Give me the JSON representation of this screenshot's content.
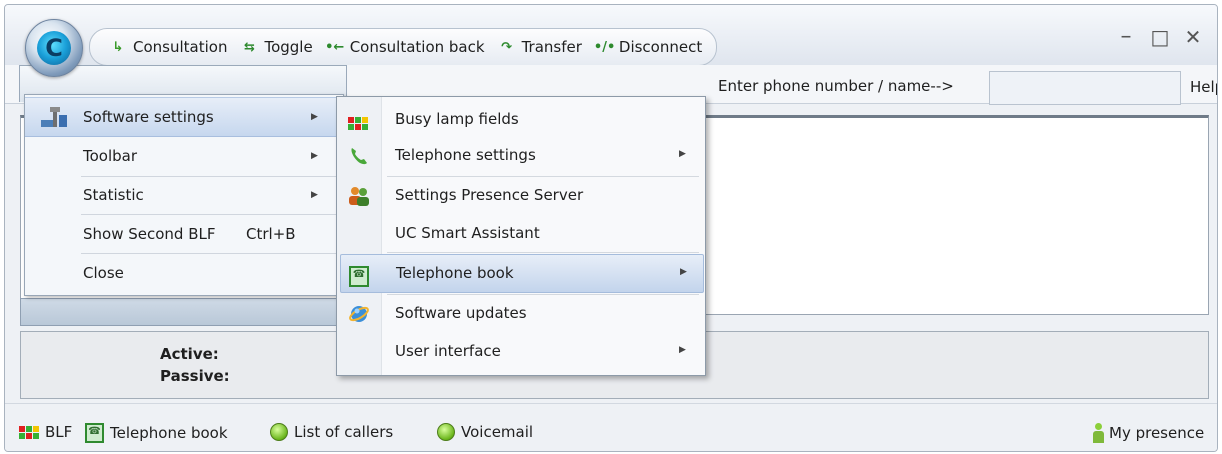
{
  "toolbar": {
    "items": [
      {
        "label": "Consultation",
        "icon": "consultation-icon",
        "glyph": "↳"
      },
      {
        "label": "Toggle",
        "icon": "toggle-icon",
        "glyph": "⇆"
      },
      {
        "label": "Consultation back",
        "icon": "consultation-back-icon",
        "glyph": "•←"
      },
      {
        "label": "Transfer",
        "icon": "transfer-icon",
        "glyph": "↷"
      },
      {
        "label": "Disconnect",
        "icon": "disconnect-icon",
        "glyph": "•/•"
      }
    ],
    "app_letter": "C"
  },
  "window_controls": {
    "minimize": "–",
    "maximize": "□",
    "close": "✕"
  },
  "search": {
    "label": "Enter phone number / name-->",
    "value": ""
  },
  "help_label": "Help",
  "main_menu": {
    "items": [
      {
        "label": "Software settings",
        "has_submenu": true
      },
      {
        "label": "Toolbar",
        "has_submenu": true
      },
      {
        "label": "Statistic",
        "has_submenu": true
      },
      {
        "label": "Show Second BLF",
        "shortcut": "Ctrl+B"
      },
      {
        "label": "Close"
      }
    ]
  },
  "submenu": {
    "items": [
      {
        "label": "Busy lamp fields",
        "icon": "busy-lamp-icon"
      },
      {
        "label": "Telephone settings",
        "icon": "phone-handset-icon",
        "has_submenu": true
      },
      {
        "label": "Settings Presence Server",
        "icon": "presence-users-icon"
      },
      {
        "label": "UC Smart Assistant"
      },
      {
        "label": "Telephone book",
        "icon": "telephone-book-icon",
        "has_submenu": true
      },
      {
        "label": "Software updates",
        "icon": "globe-update-icon"
      },
      {
        "label": "User interface",
        "has_submenu": true
      }
    ]
  },
  "status": {
    "active_label": "Active:",
    "passive_label": "Passive:"
  },
  "bottom_bar": {
    "items": [
      {
        "label": "BLF",
        "icon": "blf-icon"
      },
      {
        "label": "Telephone book",
        "icon": "telephone-book-icon"
      },
      {
        "label": "List of callers",
        "icon": "list-of-callers-icon"
      },
      {
        "label": "Voicemail",
        "icon": "voicemail-icon"
      }
    ],
    "presence_label": "My presence"
  },
  "colors": {
    "menu_highlight": "#c6d7ee",
    "window_bg": "#eef1f5",
    "blf_red": "#e02020",
    "blf_green": "#35b035",
    "blf_yellow": "#f2c500"
  },
  "arrow_glyph": "▶"
}
